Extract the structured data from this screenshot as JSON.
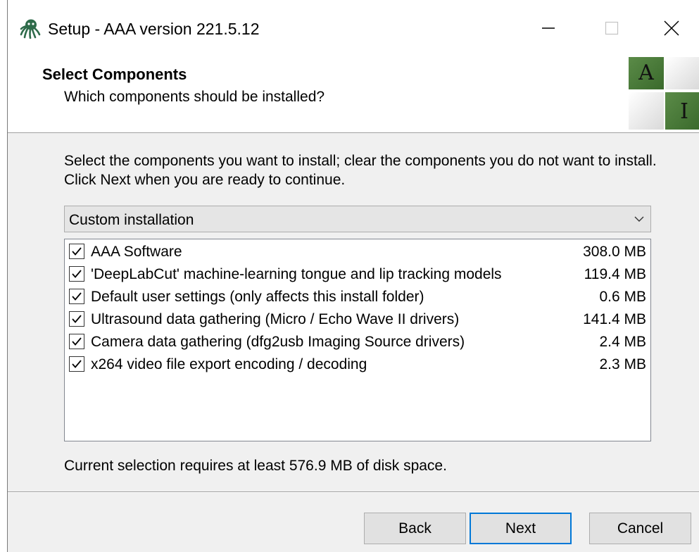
{
  "window": {
    "title": "Setup - AAA version 221.5.12",
    "icon": "octopus-icon"
  },
  "titlebar_buttons": {
    "minimize": "minimize-icon",
    "maximize": "maximize-icon",
    "close": "close-icon"
  },
  "header": {
    "title": "Select Components",
    "subtitle": "Which components should be installed?",
    "logo": {
      "letters": [
        "A",
        "I"
      ],
      "colors": {
        "green": "#4a7a3a",
        "light": "#f4f4f4"
      }
    }
  },
  "instructions": "Select the components you want to install; clear the components you do not want to install. Click Next when you are ready to continue.",
  "install_type": {
    "selected": "Custom installation"
  },
  "components": [
    {
      "label": "AAA Software",
      "size": "308.0 MB",
      "checked": true
    },
    {
      "label": "'DeepLabCut' machine-learning tongue and lip tracking models",
      "size": "119.4 MB",
      "checked": true
    },
    {
      "label": "Default user settings (only affects this install folder)",
      "size": "0.6 MB",
      "checked": true
    },
    {
      "label": "Ultrasound data gathering (Micro / Echo Wave II drivers)",
      "size": "141.4 MB",
      "checked": true
    },
    {
      "label": "Camera data gathering (dfg2usb Imaging Source drivers)",
      "size": "2.4 MB",
      "checked": true
    },
    {
      "label": "x264 video file export encoding / decoding",
      "size": "2.3 MB",
      "checked": true
    }
  ],
  "disk_space": "Current selection requires at least 576.9 MB of disk space.",
  "buttons": {
    "back": "Back",
    "next": "Next",
    "cancel": "Cancel"
  },
  "colors": {
    "focus_border": "#0078d7",
    "dialog_background": "#f0f0f0"
  }
}
